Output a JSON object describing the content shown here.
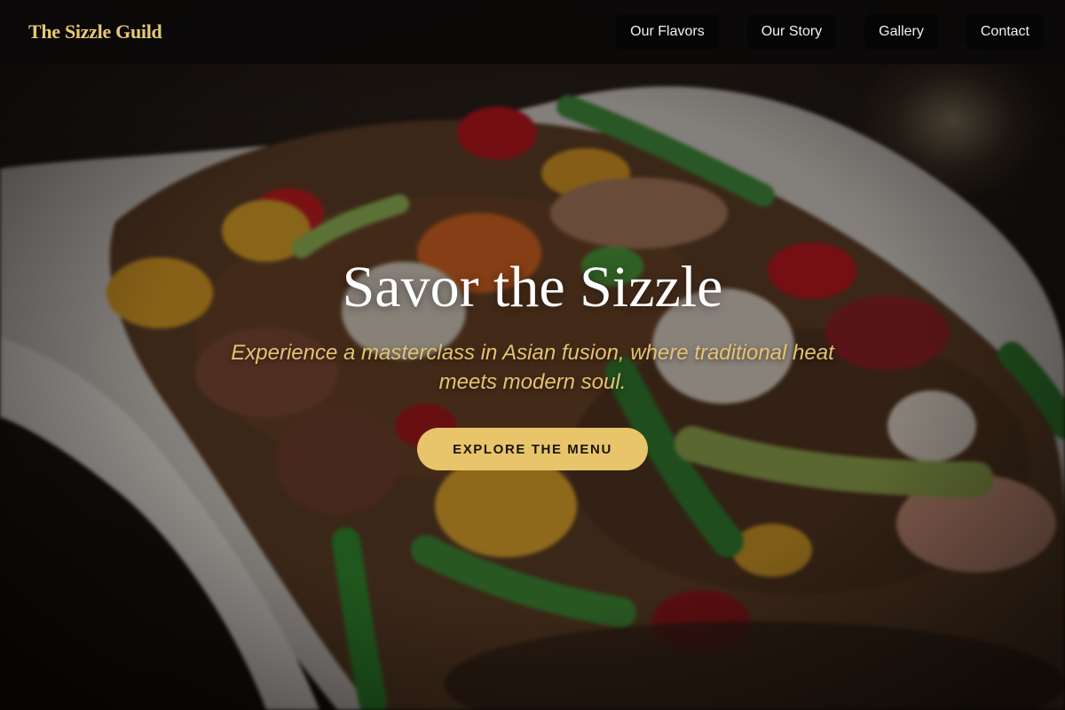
{
  "brand": {
    "name": "The Sizzle Guild",
    "color": "#e7c877"
  },
  "nav": {
    "items": [
      {
        "label": "Our Flavors"
      },
      {
        "label": "Our Story"
      },
      {
        "label": "Gallery"
      },
      {
        "label": "Contact"
      }
    ]
  },
  "hero": {
    "title": "Savor the Sizzle",
    "subtitle": "Experience a masterclass in Asian fusion, where traditional heat meets modern soul.",
    "cta_label": "EXPLORE THE MENU",
    "background_image": "stir-fry-dish-photo"
  },
  "colors": {
    "accent": "#e8c56b",
    "nav_bg": "#050505"
  }
}
